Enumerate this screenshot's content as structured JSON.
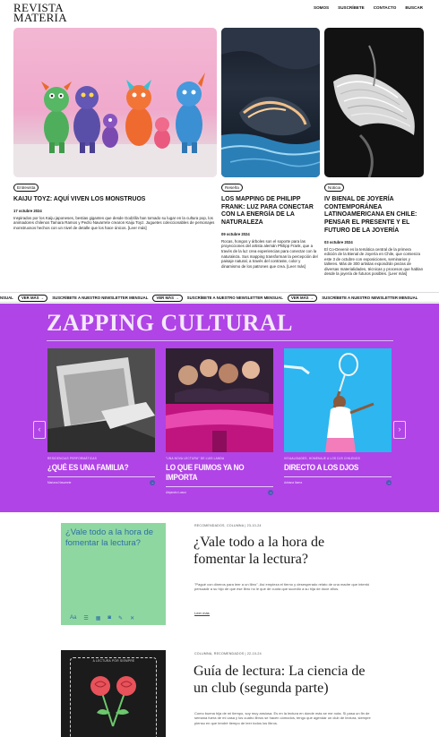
{
  "header": {
    "logo_line1": "REVISTA",
    "logo_line2": "MATERIA",
    "nav": [
      "SOMOS",
      "SUSCRÍBETE",
      "CONTACTO",
      "BUSCAR"
    ]
  },
  "articles": [
    {
      "badge": "Entrevista",
      "title": "KAIJU TOYZ: AQUÍ VIVEN LOS MONSTRUOS",
      "date": "17 octubre 2024",
      "excerpt": "Inspirados por los Kaiju japoneses, bestias gigantes que desde Godzilla han tomado su lugar en la cultura pop, los animadores chilenos Tamara Ramos y Pedro Navarrete crearon Kaiju Toyz. Juguetes coleccionables de personajes monstruosos hechos con un nivel de detalle que los hace únicos. [Leer más]"
    },
    {
      "badge": "Reseña",
      "title": "LOS MAPPING DE PHILIPP FRANK: LUZ PARA CONECTAR CON LA ENERGÍA DE LA NATURALEZA",
      "date": "09 octubre 2024",
      "excerpt": "Rocas, hongos y árboles son el soporte para las proyecciones del artista alemán Philipp Frank, que a través de la luz crea experiencias para conectar con la naturaleza. Sus mapping transforman la percepción del paisaje natural, a través del contraste, color y dinamismo de los patrones que crea. [Leer más]"
    },
    {
      "badge": "Noticia",
      "title": "IV BIENAL DE JOYERÍA CONTEMPORÁNEA LATINOAMERICANA EN CHILE: PENSAR EL PRESENTE Y EL FUTURO DE LA JOYERÍA",
      "date": "03 octubre 2024",
      "excerpt": "El Co-Devenir es la temática central de la primera edición de la Bienal de Joyería en Chile, que comienza este 3 de octubre con exposiciones, seminarios y talleres. Más de 300 artistas expondrán piezas de diversas materialidades, técnicas y procesos que hablan desde la joyería de futuros posibles. [Leer más]"
    }
  ],
  "ticker": {
    "text": "SUSCRÍBETE A NUESTRO NEWSLETTER MENSUAL",
    "start": "NSUAL",
    "button": "VER MÁS →"
  },
  "zapping": {
    "title": "ZAPPING CULTURAL",
    "prev": "‹",
    "next": "›",
    "cards": [
      {
        "category": "RESIDENCIAS PERFORMÁTICAS",
        "title": "¿QUÉ ES UNA FAMILIA?",
        "author": "Mariana Navarrete"
      },
      {
        "category": "\"UNA NOVA LECTURA\" DE LUIS LANDA",
        "title": "LO QUE FUIMOS YA NO IMPORTA",
        "author": "Alejandro Lasco"
      },
      {
        "category": "VISUALIDADES, HOMENAJE A LOS DJS CHILENOS",
        "title": "DIRECTO A LOS DJOS",
        "author": "Adriana Ibarra"
      }
    ]
  },
  "recommendations": [
    {
      "meta": "RECOMENDADOS, COLUMNA | 23-10-24",
      "title": "¿Vale todo a la hora de fomentar la lectura?",
      "image_text": "¿Vale todo a la hora de fomentar la lectura?",
      "excerpt": "\"Pagué con dineros para leer a un libro\". Así empieza el tierno y desesperado relato de una madre que intentó persuadir a su hijo de que ese libro no le que de cuota que sucedió a su hija de doce años.",
      "link": "Leer más"
    },
    {
      "meta": "COLUMNA, RECOMENDADOS | 22-10-24",
      "title": "Guía de lectura: La ciencia de un club (segunda parte)",
      "image_text": "A LECTURA POR SIEMPRE",
      "excerpt": "Como buena hija de mi tiempo, soy muy ansiosa. Es en la lectura en donde más se me nota. Si pasa un fin de semana fuera de mi casa y los cuatro libros se hacen cómodos, tengo que agendar un club de lectura, siempre pienso en que tendré tiempo de leer todos los libros."
    }
  ],
  "colors": {
    "zapping_bg": "#b044e6",
    "rec_green": "#8fd7a0",
    "arrow_blue": "#4b5ab5"
  }
}
